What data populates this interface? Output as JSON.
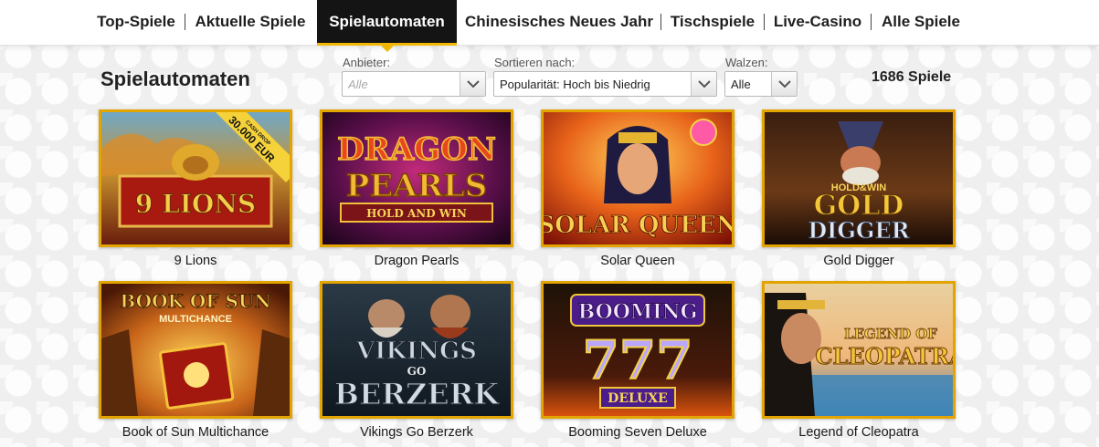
{
  "nav": {
    "items": [
      {
        "label": "Top-Spiele"
      },
      {
        "label": "Aktuelle Spiele"
      },
      {
        "label": "Spielautomaten"
      },
      {
        "label": "Chinesisches Neues Jahr"
      },
      {
        "label": "Tischspiele"
      },
      {
        "label": "Live-Casino"
      },
      {
        "label": "Alle Spiele"
      }
    ],
    "active": "Spielautomaten"
  },
  "page": {
    "title": "Spielautomaten",
    "count": "1686 Spiele"
  },
  "filters": {
    "provider": {
      "label": "Anbieter:",
      "placeholder": "Alle",
      "options": [
        "Alle"
      ]
    },
    "sort": {
      "label": "Sortieren nach:",
      "value": "Popularität: Hoch bis Niedrig",
      "options": [
        "Popularität: Hoch bis Niedrig"
      ]
    },
    "reels": {
      "label": "Walzen:",
      "value": "Alle",
      "options": [
        "Alle"
      ]
    }
  },
  "games": [
    {
      "name": "9 Lions",
      "art": {
        "line1": "9 LIONS",
        "badge_top": "CASH DROP",
        "badge_main": "30.000 EUR"
      }
    },
    {
      "name": "Dragon Pearls",
      "art": {
        "line1": "DRAGON",
        "line2": "PEARLS",
        "line3": "HOLD AND WIN"
      }
    },
    {
      "name": "Solar Queen",
      "art": {
        "line1": "SOLAR QUEEN"
      }
    },
    {
      "name": "Gold Digger",
      "art": {
        "line0": "HOLD&WIN",
        "line1": "GOLD",
        "line2": "DIGGER"
      }
    },
    {
      "name": "Book of Sun Multichance",
      "art": {
        "line1": "BOOK OF SUN",
        "line2": "MULTICHANCE"
      }
    },
    {
      "name": "Vikings Go Berzerk",
      "art": {
        "line1": "VIKINGS",
        "line2": "GO",
        "line3": "BERZERK"
      }
    },
    {
      "name": "Booming Seven Deluxe",
      "art": {
        "line1": "BOOMING",
        "line2": "777",
        "line3": "DELUXE"
      }
    },
    {
      "name": "Legend of Cleopatra",
      "art": {
        "line1": "LEGEND OF",
        "line2": "CLEOPATRA"
      }
    }
  ],
  "colors": {
    "accent": "#f2b705",
    "tile_border": "#e3a400",
    "nav_active_bg": "#141414"
  }
}
